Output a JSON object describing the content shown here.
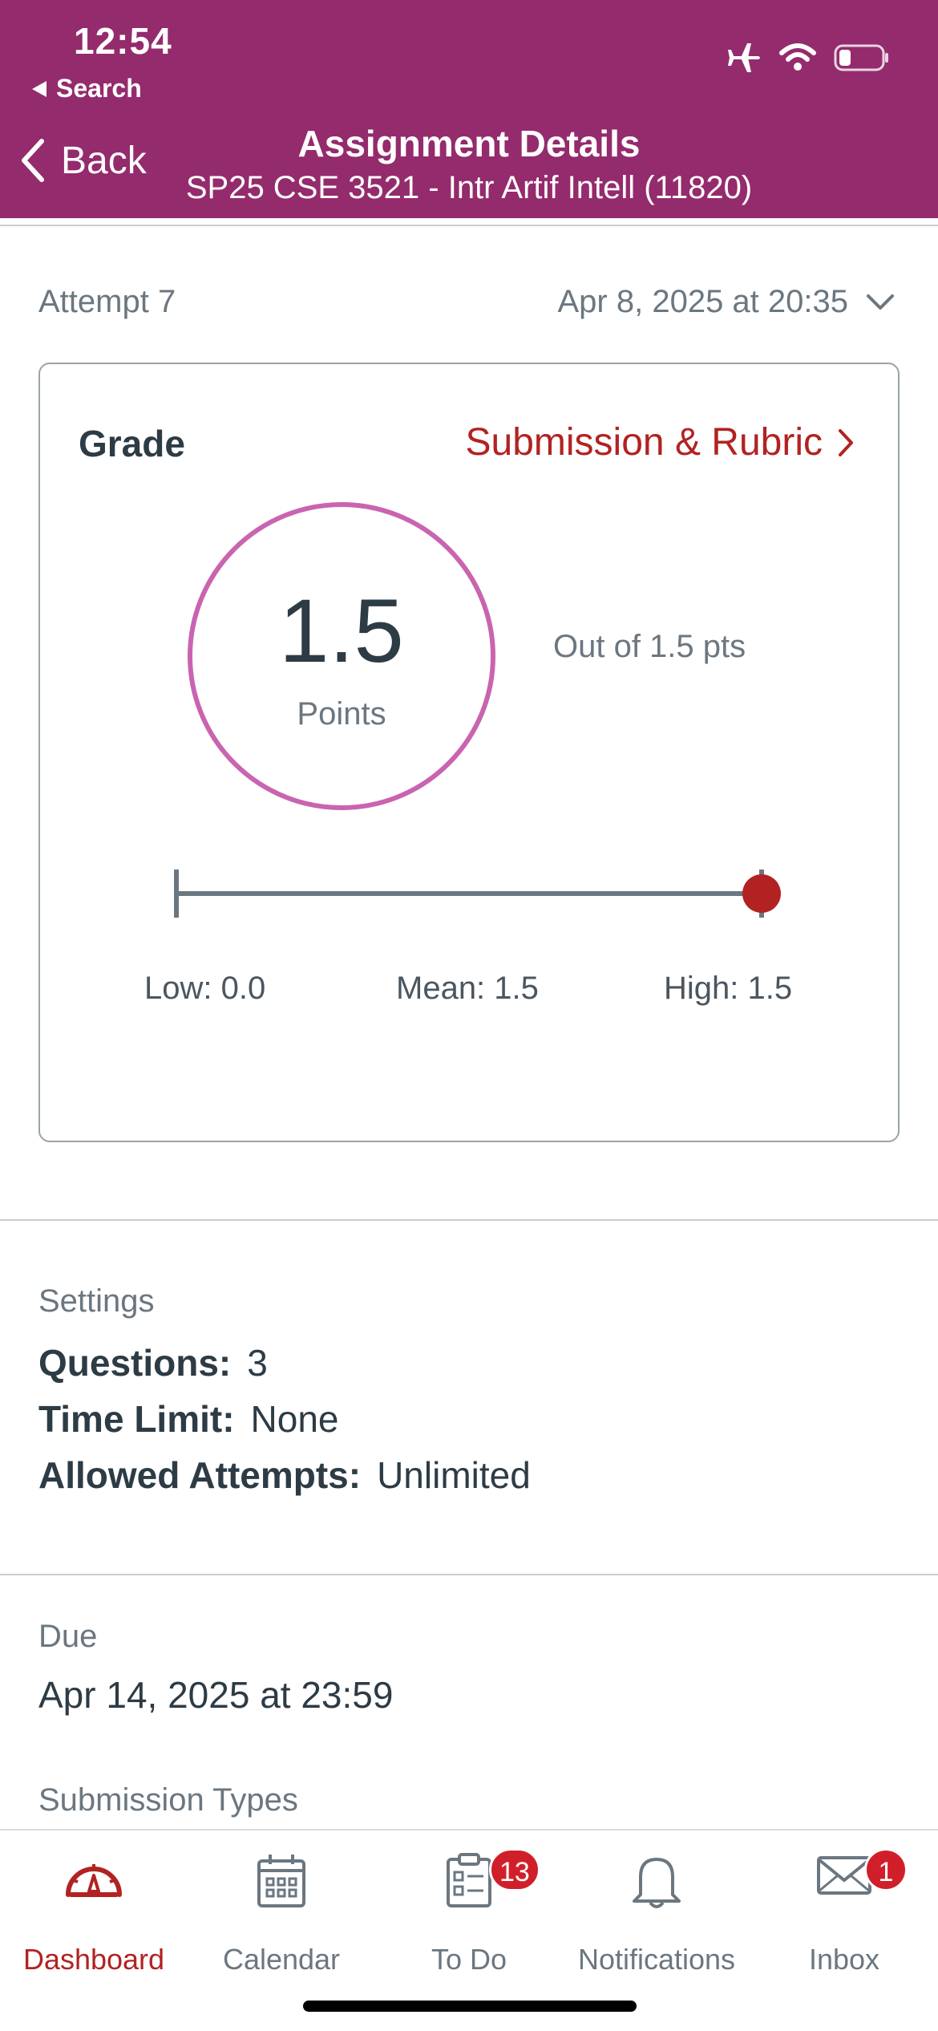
{
  "status_bar": {
    "time": "12:54",
    "back_app": "Search"
  },
  "nav": {
    "back_label": "Back",
    "title": "Assignment Details",
    "subtitle": "SP25 CSE 3521 - Intr Artif Intell (11820)"
  },
  "attempt": {
    "label": "Attempt 7",
    "date": "Apr 8, 2025 at 20:35"
  },
  "grade": {
    "title": "Grade",
    "rubric_link": "Submission & Rubric",
    "score": "1.5",
    "score_unit": "Points",
    "out_of": "Out of 1.5 pts",
    "low": "Low: 0.0",
    "mean": "Mean: 1.5",
    "high": "High: 1.5",
    "range": {
      "low": 0.0,
      "mean": 1.5,
      "high": 1.5,
      "score": 1.5
    }
  },
  "settings": {
    "label": "Settings",
    "questions_key": "Questions:",
    "questions_val": "3",
    "time_limit_key": "Time Limit:",
    "time_limit_val": "None",
    "attempts_key": "Allowed Attempts:",
    "attempts_val": "Unlimited"
  },
  "due": {
    "label": "Due",
    "value": "Apr 14, 2025 at 23:59"
  },
  "submission_types": {
    "label": "Submission Types"
  },
  "tabs": [
    {
      "label": "Dashboard",
      "icon": "dashboard-icon",
      "active": true
    },
    {
      "label": "Calendar",
      "icon": "calendar-icon"
    },
    {
      "label": "To Do",
      "icon": "todo-icon",
      "badge": "13"
    },
    {
      "label": "Notifications",
      "icon": "bell-icon"
    },
    {
      "label": "Inbox",
      "icon": "envelope-icon",
      "badge": "1"
    }
  ],
  "colors": {
    "header": "#942b6d",
    "accent": "#b22222",
    "score_ring": "#c964b0",
    "badge": "#d11f2a"
  }
}
